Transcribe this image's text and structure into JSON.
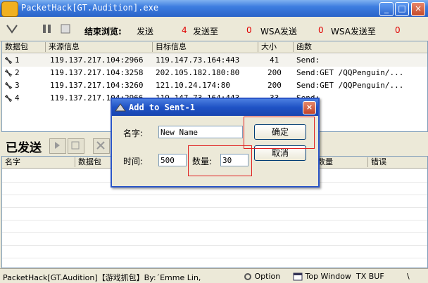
{
  "window": {
    "title": "PacketHack[GT.Audition].exe"
  },
  "toolbar": {
    "stop_label": "结束浏览:",
    "send_label": "发送",
    "send_count": "4",
    "sendto_label": "发送至",
    "sendto_count": "0",
    "wsasend_label": "WSA发送",
    "wsasend_count": "0",
    "wsasendto_label": "WSA发送至",
    "wsasendto_count": "0"
  },
  "packet_list": {
    "columns": [
      "数据包",
      "来源信息",
      "目标信息",
      "大小",
      "函数"
    ],
    "rows": [
      {
        "id": "1",
        "source": "119.137.217.104:2966",
        "target": "119.147.73.164:443",
        "size": "41",
        "func": "Send:"
      },
      {
        "id": "2",
        "source": "119.137.217.104:3258",
        "target": "202.105.182.180:80",
        "size": "200",
        "func": "Send:GET /QQPenguin/..."
      },
      {
        "id": "3",
        "source": "119.137.217.104:3260",
        "target": "121.10.24.174:80",
        "size": "200",
        "func": "Send:GET /QQPenguin/..."
      },
      {
        "id": "4",
        "source": "119.137.217.104:2966",
        "target": "119.147.73.164:443",
        "size": "33",
        "func": "Send:"
      }
    ]
  },
  "sent": {
    "title": "已发送",
    "columns": [
      "名字",
      "数据包",
      "数量",
      "错误"
    ]
  },
  "dialog": {
    "title": "Add to Sent-1",
    "name_label": "名字:",
    "name_value": "New Name",
    "time_label": "时间:",
    "time_value": "500",
    "count_label": "数量:",
    "count_value": "30",
    "ok_label": "确定",
    "cancel_label": "取消"
  },
  "status": {
    "app": "PacketHack[GT.Audition]【游戏抓包】By:ˊEmme Lin,",
    "option": "Option",
    "top_window": "Top Window",
    "tx_buf": "TX BUF",
    "slash": "\\"
  }
}
